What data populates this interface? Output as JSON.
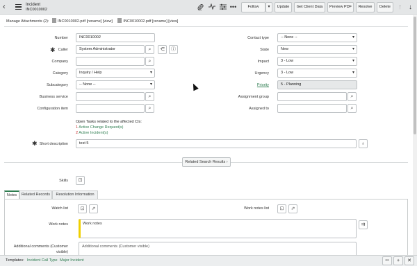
{
  "header": {
    "back_icon": "chevron-left-icon",
    "title": "Incident",
    "number": "INC0010002",
    "icons": [
      "paperclip-icon",
      "activity-icon",
      "sliders-icon",
      "more-icon"
    ],
    "buttons": {
      "follow": "Follow",
      "follow_dd": "▾",
      "update": "Update",
      "get_client_data": "Get Client Data",
      "preview_pdf": "Preview PDF",
      "resolve": "Resolve",
      "delete": "Delete"
    },
    "nav_up": "↑",
    "nav_down": "↓"
  },
  "attachments": {
    "label": "Manage Attachments (2):",
    "file1": "INC0010002.pdf",
    "file2": "INC0010002.pdf",
    "rename": "[rename]",
    "view": "[view]"
  },
  "form": {
    "number_label": "Number",
    "number_value": "INC0010002",
    "caller_label": "Caller",
    "caller_value": "System Administrator",
    "company_label": "Company",
    "company_value": "",
    "category_label": "Category",
    "category_value": "Inquiry / Help",
    "subcategory_label": "Subcategory",
    "subcategory_value": "-- None --",
    "business_service_label": "Business service",
    "business_service_value": "",
    "config_item_label": "Configuration item",
    "config_item_value": "",
    "contact_type_label": "Contact type",
    "contact_type_value": "-- None --",
    "state_label": "State",
    "state_value": "New",
    "impact_label": "Impact",
    "impact_value": "3 - Low",
    "urgency_label": "Urgency",
    "urgency_value": "3 - Low",
    "priority_label": "Priority",
    "priority_value": "5 - Planning",
    "assignment_group_label": "Assignment group",
    "assignment_group_value": "",
    "assigned_to_label": "Assigned to",
    "assigned_to_value": "",
    "open_tasks_title": "Open Tasks related to the affected CIs:",
    "change_count": "1",
    "change_text": "Active Change Request(s)",
    "incident_count": "2",
    "incident_text": "Active Incident(s)",
    "short_desc_label": "Short description",
    "short_desc_value": "test 5",
    "related_search": "Related Search Results",
    "skills_label": "Skills"
  },
  "tabs": [
    "Notes",
    "Related Records",
    "Resolution Information"
  ],
  "notes": {
    "watch_list_label": "Watch list",
    "work_notes_list_label": "Work notes list",
    "work_notes_label": "Work notes",
    "work_notes_placeholder": "Work notes",
    "additional_comments_label": "Additional comments (Customer visible)",
    "additional_comments_placeholder": "Additional comments (Customer visible)"
  },
  "footer": {
    "templates_label": "Templates:",
    "template1": "Incident Call Type",
    "template2": "Major Incident",
    "more": "•••",
    "plus": "+",
    "close": "✕"
  },
  "accent_color": "#2e7d50"
}
